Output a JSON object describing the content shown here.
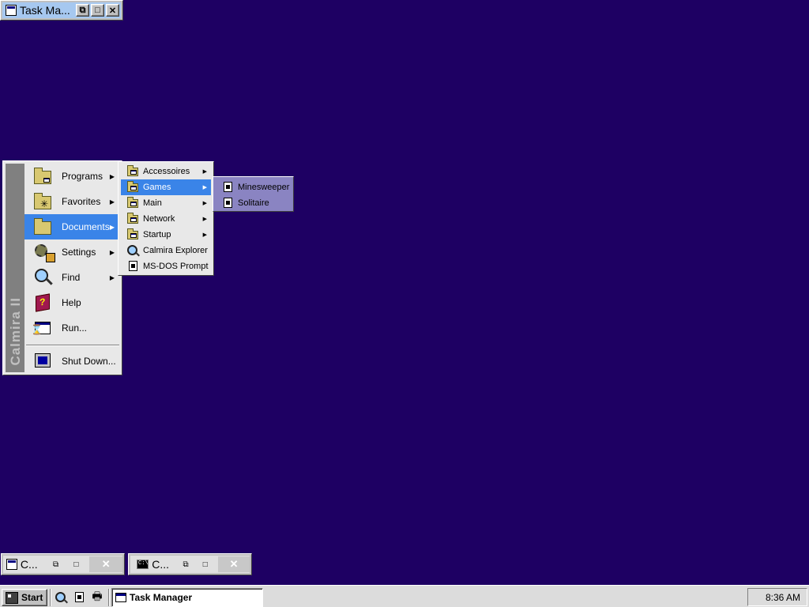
{
  "task_manager_window": {
    "title": "Task Ma..."
  },
  "start_menu": {
    "banner": "Calmira II",
    "items": [
      {
        "label": "Programs",
        "icon": "programs-folder-icon",
        "submenu": true
      },
      {
        "label": "Favorites",
        "icon": "favorites-folder-icon",
        "submenu": true
      },
      {
        "label": "Documents",
        "icon": "documents-folder-icon",
        "submenu": true,
        "highlighted": true
      },
      {
        "label": "Settings",
        "icon": "settings-icon",
        "submenu": true
      },
      {
        "label": "Find",
        "icon": "find-icon",
        "submenu": true
      },
      {
        "label": "Help",
        "icon": "help-book-icon",
        "submenu": false
      },
      {
        "label": "Run...",
        "icon": "run-icon",
        "submenu": false
      },
      {
        "label": "Shut Down...",
        "icon": "shutdown-icon",
        "submenu": false
      }
    ]
  },
  "documents_submenu": {
    "items": [
      {
        "label": "Accessoires",
        "submenu": true
      },
      {
        "label": "Games",
        "submenu": true,
        "highlighted": true
      },
      {
        "label": "Main",
        "submenu": true
      },
      {
        "label": "Network",
        "submenu": true
      },
      {
        "label": "Startup",
        "submenu": true
      },
      {
        "label": "Calmira Explorer",
        "submenu": false
      },
      {
        "label": "MS-DOS Prompt",
        "submenu": false
      }
    ]
  },
  "games_submenu": {
    "items": [
      {
        "label": "Minesweeper"
      },
      {
        "label": "Solitaire"
      }
    ]
  },
  "minimized_windows": [
    {
      "label": "C..."
    },
    {
      "label": "C..."
    }
  ],
  "taskbar": {
    "start_label": "Start",
    "task_label": "Task Manager",
    "clock": "8:36 AM"
  },
  "colors": {
    "desktop": "#1e0063",
    "highlight": "#3a84e8",
    "games_menu_bg": "#8a84c2"
  }
}
